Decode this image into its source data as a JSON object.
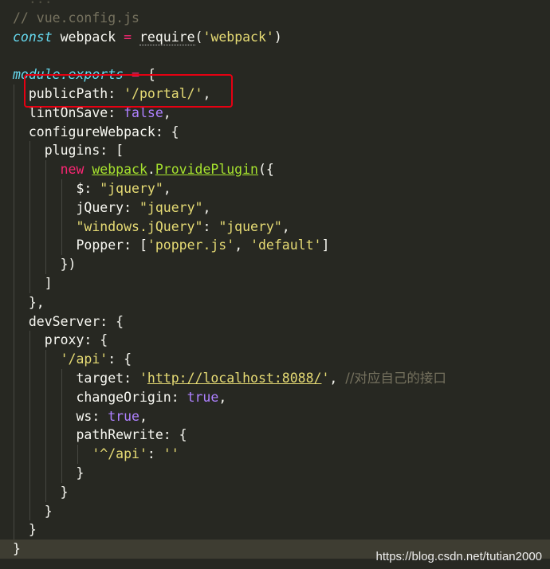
{
  "code": {
    "line0": "  ...",
    "comment_file": "// vue.config.js",
    "kw_const": "const",
    "var_webpack": "webpack",
    "op_eq": "=",
    "fn_require": "require",
    "str_webpack": "'webpack'",
    "kw_module": "module",
    "kw_exports": ".exports",
    "brace_open": "{",
    "key_publicPath": "publicPath:",
    "str_portal": "'/portal/'",
    "key_lintOnSave": "lintOnSave:",
    "bool_false": "false",
    "key_configureWebpack": "configureWebpack: {",
    "key_plugins": "plugins: [",
    "kw_new": "new",
    "obj_webpack": "webpack",
    "fn_provide": "ProvidePlugin",
    "key_dollar": "$:",
    "str_jquery": "\"jquery\"",
    "key_jQuery": "jQuery:",
    "str_windows_jquery": "\"windows.jQuery\"",
    "key_popper": "Popper:",
    "str_popper": "'popper.js'",
    "str_default": "'default'",
    "close_paren": "})",
    "close_bracket": "]",
    "close_obj_comma": "},",
    "key_devServer": "devServer: {",
    "key_proxy": "proxy: {",
    "str_api": "'/api'",
    "key_target": "target:",
    "str_url": "http://localhost:8088/",
    "comment_iface": "//对应自己的接口",
    "key_changeOrigin": "changeOrigin:",
    "bool_true": "true",
    "key_ws": "ws:",
    "key_pathRewrite": "pathRewrite: {",
    "str_caret_api": "'^/api'",
    "str_empty": "''",
    "close_brace": "}"
  },
  "watermark": "https://blog.csdn.net/tutian2000",
  "colors": {
    "background": "#272822",
    "highlight_box": "#e60012",
    "keyword": "#66d9ef",
    "string": "#e6db74",
    "comment": "#75715e",
    "boolean": "#ae81ff",
    "function": "#a6e22e",
    "operator": "#f92672"
  }
}
